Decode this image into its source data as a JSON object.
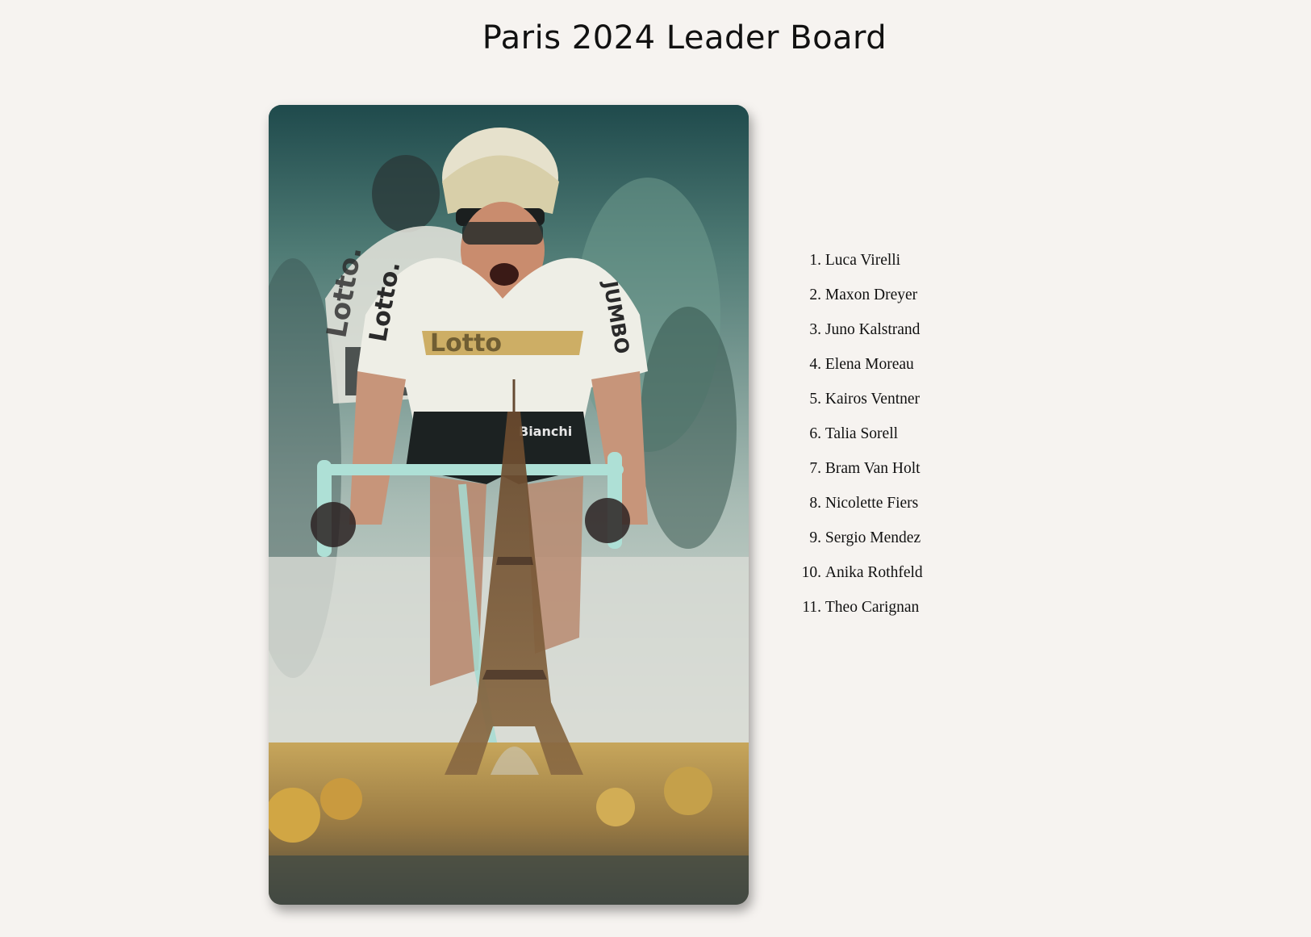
{
  "page": {
    "title": "Paris 2024 Leader Board"
  },
  "hero_image": {
    "icon": "cyclist-eiffel-tower-photo",
    "jersey_text": [
      "Lotto.",
      "Lotto.",
      "JUMBO",
      "Bianchi"
    ]
  },
  "leaderboard": {
    "entries": [
      {
        "rank": "1.",
        "name": "Luca Virelli"
      },
      {
        "rank": "2.",
        "name": "Maxon Dreyer"
      },
      {
        "rank": "3.",
        "name": "Juno Kalstrand"
      },
      {
        "rank": "4.",
        "name": "Elena Moreau"
      },
      {
        "rank": "5.",
        "name": "Kairos Ventner"
      },
      {
        "rank": "6.",
        "name": "Talia Sorell"
      },
      {
        "rank": "7.",
        "name": "Bram Van Holt"
      },
      {
        "rank": "8.",
        "name": "Nicolette Fiers"
      },
      {
        "rank": "9.",
        "name": "Sergio Mendez"
      },
      {
        "rank": "10.",
        "name": "Anika Rothfeld"
      },
      {
        "rank": "11.",
        "name": "Theo Carignan"
      }
    ]
  },
  "colors": {
    "background": "#f6f3f0",
    "text": "#111111",
    "photo_teal": "#2e5858",
    "photo_gold": "#b9a070"
  }
}
